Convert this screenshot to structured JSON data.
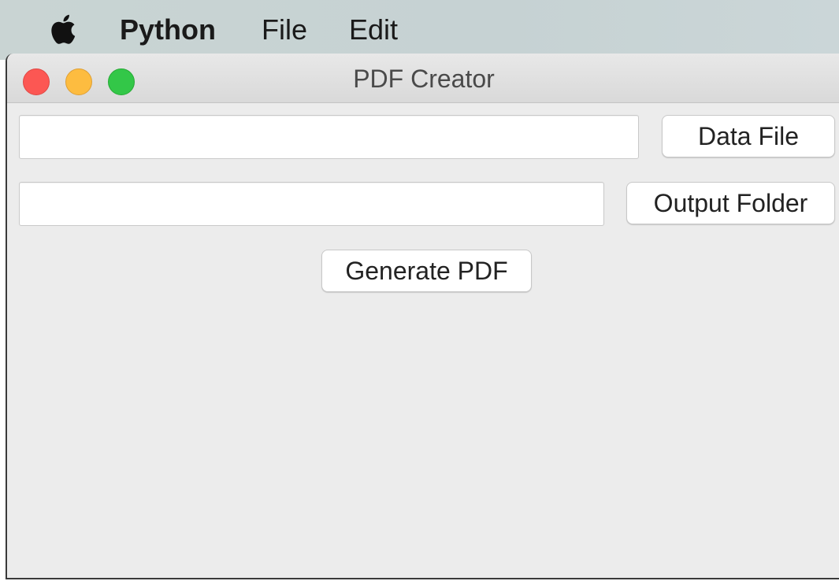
{
  "menubar": {
    "apple_icon": "apple-logo-icon",
    "items": [
      {
        "label": "Python",
        "bold": true
      },
      {
        "label": "File",
        "bold": false
      },
      {
        "label": "Edit",
        "bold": false
      }
    ]
  },
  "window": {
    "title": "PDF Creator",
    "traffic_lights": {
      "close_color": "#fc5753",
      "minimize_color": "#fdbc40",
      "maximize_color": "#33c748"
    }
  },
  "form": {
    "data_file": {
      "value": "",
      "placeholder": "",
      "button_label": "Data File"
    },
    "output_folder": {
      "value": "",
      "placeholder": "",
      "button_label": "Output Folder"
    },
    "generate_label": "Generate PDF"
  }
}
